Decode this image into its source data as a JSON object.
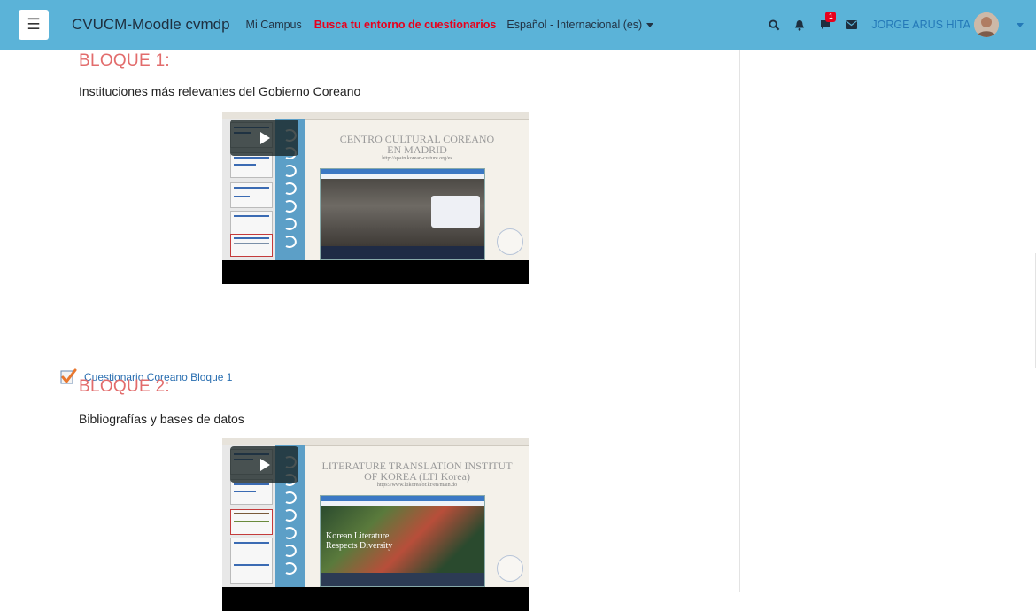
{
  "navbar": {
    "menu_icon": "hamburger-icon",
    "site_name": "CVUCM-Moodle cvmdp",
    "links": [
      {
        "label": "Mi Campus"
      },
      {
        "label": "Busca tu entorno de cuestionarios"
      }
    ],
    "language": "Español - Internacional (es)",
    "notification_count": "1",
    "user_name": "JORGE ARUS HITA",
    "icons": [
      "search-icon",
      "bell-icon",
      "comment-icon",
      "envelope-icon",
      "avatar",
      "chevron-down-icon"
    ],
    "highlight_color": "#e8001c",
    "bar_color": "#5bb3d8"
  },
  "sections": [
    {
      "title": "BLOQUE 1:",
      "subtitle": "Instituciones más relevantes del Gobierno Coreano",
      "video": {
        "slide_title_line1": "CENTRO CULTURAL COREANO",
        "slide_title_line2": "EN MADRID",
        "slide_url": "http://spain.korean-culture.org/es",
        "play_icon": "play-icon"
      },
      "activity": {
        "label": "Cuestionario Coreano Bloque 1",
        "icon": "quiz-checkmark-icon"
      }
    },
    {
      "title": "BLOQUE 2:",
      "subtitle": "Bibliografías y bases de datos",
      "video": {
        "slide_title_line1": "LITERATURE TRANSLATION INSTITUT",
        "slide_title_line2": "OF KOREA (LTI Korea)",
        "slide_url": "https://www.ltikorea.or.kr/en/main.do",
        "hero_line1": "Korean Literature",
        "hero_line2": "Respects Diversity",
        "play_icon": "play-icon"
      }
    }
  ],
  "colors": {
    "section_title": "#e26c6c",
    "link": "#2a6fb1",
    "user_link": "#2479b8"
  }
}
